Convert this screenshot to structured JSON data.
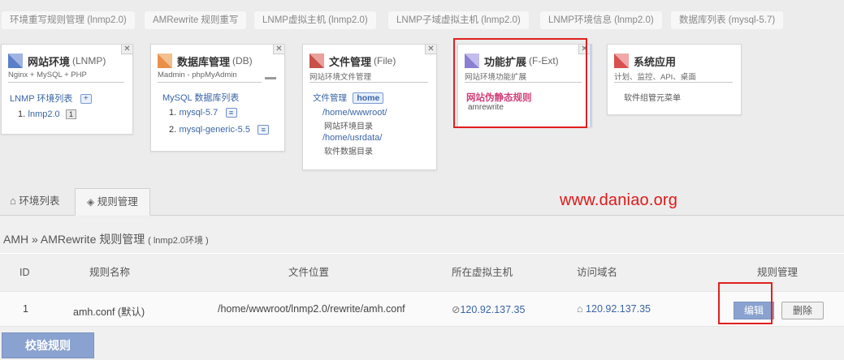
{
  "top_tabs": [
    "环境重写规则管理 (lnmp2.0)",
    "AMRewrite 规则重写",
    "LNMP虚拟主机 (lnmp2.0)",
    "LNMP子域虚拟主机 (lnmp2.0)",
    "LNMP环境信息 (lnmp2.0)",
    "数据库列表 (mysql-5.7)"
  ],
  "cards": {
    "lnmp": {
      "title": "网站环境",
      "tag": "(LNMP)",
      "subtitle": "Nginx + MySQL + PHP",
      "list_label": "LNMP 环境列表",
      "plus": "+",
      "item": "1.",
      "item_link": "lnmp2.0",
      "item_count": "1",
      "icon_color": "#5a7fc8"
    },
    "db": {
      "title": "数据库管理",
      "tag": "(DB)",
      "subtitle": "Madmin - phpMyAdmin",
      "list_label": "MySQL 数据库列表",
      "items": [
        {
          "num": "1.",
          "name": "mysql-5.7",
          "icon": "≡"
        },
        {
          "num": "2.",
          "name": "mysql-generic-5.5",
          "icon": "≡"
        }
      ],
      "icon_color": "#e8904a"
    },
    "file": {
      "title": "文件管理",
      "tag": "(File)",
      "subtitle": "网站环境文件管理",
      "label": "文件管理",
      "home": "home",
      "paths": [
        {
          "path": "/home/wwwroot/",
          "desc": "网站环境目录"
        },
        {
          "path": "/home/usrdata/",
          "desc": "软件数据目录"
        }
      ],
      "icon_color": "#c8504a"
    },
    "ext": {
      "title": "功能扩展",
      "tag": "(F-Ext)",
      "subtitle": "网站环境功能扩展",
      "link": "网站伪静态规则",
      "link_sub": "amrewrite",
      "icon_color": "#8a7fd0"
    },
    "sys": {
      "title": "系统应用",
      "subtitle": "计划、监控、API、桌面",
      "body": "软件组管元菜单",
      "icon_color": "#d85050"
    },
    "close": "✕"
  },
  "nav": {
    "tab1": "环境列表",
    "tab2": "规则管理"
  },
  "watermark": "www.daniao.org",
  "page": {
    "heading": "AMH » AMRewrite 规则管理",
    "heading_paren": "( lnmp2.0环境 )"
  },
  "table": {
    "headers": [
      "ID",
      "规则名称",
      "文件位置",
      "所在虚拟主机",
      "访问域名",
      "规则管理"
    ],
    "rows": [
      {
        "id": "1",
        "name": "amh.conf (默认)",
        "path": "/home/wwwroot/lnmp2.0/rewrite/amh.conf",
        "host": "120.92.137.35",
        "domain": "120.92.137.35",
        "edit": "编辑",
        "delete": "删除"
      }
    ]
  },
  "verify_button": "校验规则",
  "colors": {
    "accent": "#3a64a5",
    "highlight_red": "#e0201e",
    "button_blue": "#8aa2cf",
    "ext_link": "#d0407a"
  }
}
